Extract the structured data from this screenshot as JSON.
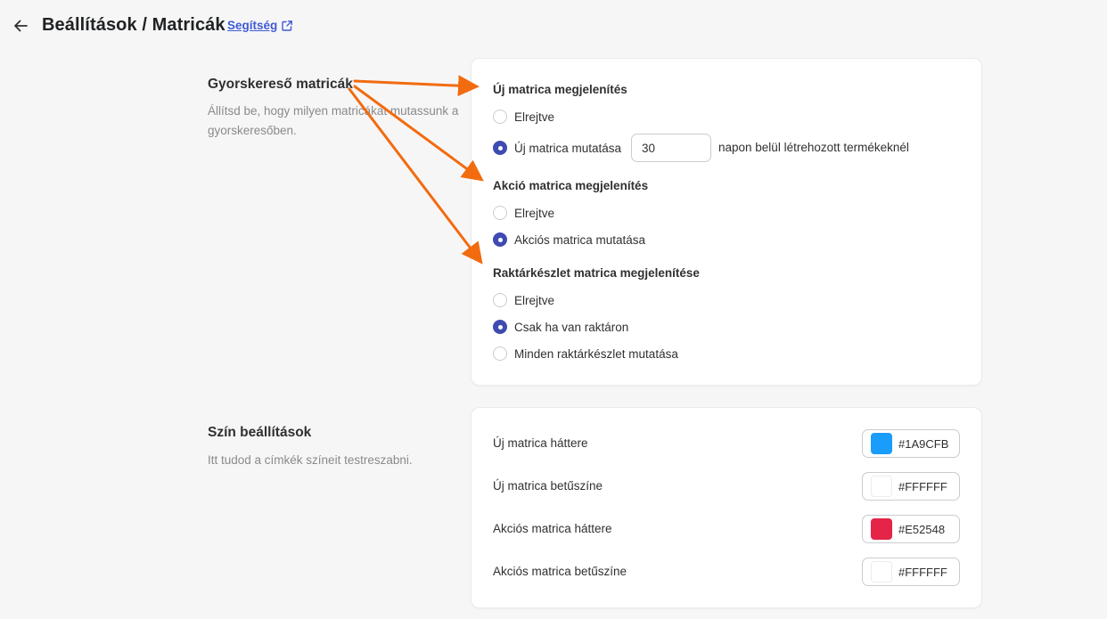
{
  "header": {
    "title": "Beállítások / Matricák",
    "help_label": "Segítség"
  },
  "quick_search": {
    "title": "Gyorskereső matricák",
    "description": "Állítsd be, hogy milyen matricákat mutassunk a gyorskeresőben.",
    "new_badge": {
      "title": "Új matrica megjelenítés",
      "option_hidden": "Elrejtve",
      "option_show": "Új matrica mutatása",
      "days_value": "30",
      "days_suffix": "napon belül létrehozott termékeknél",
      "selected": "option_show"
    },
    "sale_badge": {
      "title": "Akció matrica megjelenítés",
      "option_hidden": "Elrejtve",
      "option_show": "Akciós matrica mutatása",
      "selected": "option_show"
    },
    "stock_badge": {
      "title": "Raktárkészlet matrica megjelenítése",
      "option_hidden": "Elrejtve",
      "option_in_stock": "Csak ha van raktáron",
      "option_all": "Minden raktárkészlet mutatása",
      "selected": "option_in_stock"
    }
  },
  "colors": {
    "title": "Szín beállítások",
    "description": "Itt tudod a címkék színeit testreszabni.",
    "items": [
      {
        "label": "Új matrica háttere",
        "value": "#1A9CFB",
        "swatch": "#1A9CFB"
      },
      {
        "label": "Új matrica betűszíne",
        "value": "#FFFFFF",
        "swatch": "#FFFFFF"
      },
      {
        "label": "Akciós matrica háttere",
        "value": "#E52548",
        "swatch": "#E52548"
      },
      {
        "label": "Akciós matrica betűszíne",
        "value": "#FFFFFF",
        "swatch": "#FFFFFF"
      }
    ]
  },
  "theme": {
    "accent": "#3F4BB0",
    "link": "#3F5BD5",
    "annotation_arrow": "#F26B0F"
  },
  "icons": {
    "back": "arrow-left-icon",
    "external": "external-link-icon"
  }
}
